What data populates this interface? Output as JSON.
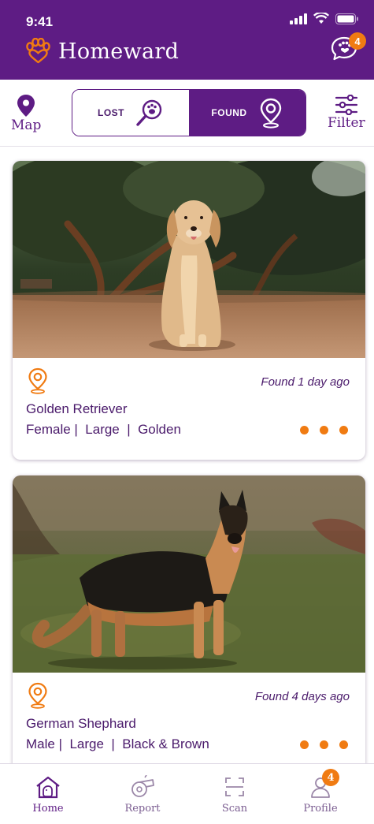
{
  "status_bar": {
    "time": "9:41"
  },
  "header": {
    "app_name": "Homeward",
    "chat_badge": "4"
  },
  "toolbar": {
    "map_label": "Map",
    "filter_label": "Filter",
    "lost_label": "LOST",
    "found_label": "FOUND",
    "selected": "FOUND"
  },
  "listings": [
    {
      "found_time": "Found 1 day ago",
      "breed": "Golden Retriever",
      "sex": "Female",
      "size": "Large",
      "color": "Golden"
    },
    {
      "found_time": "Found 4 days ago",
      "breed": "German Shephard",
      "sex": "Male",
      "size": "Large",
      "color": "Black & Brown"
    }
  ],
  "bottom_nav": {
    "items": [
      {
        "label": "Home",
        "icon": "home-icon"
      },
      {
        "label": "Report",
        "icon": "whistle-icon"
      },
      {
        "label": "Scan",
        "icon": "scan-icon"
      },
      {
        "label": "Profile",
        "icon": "profile-icon"
      }
    ],
    "profile_badge": "4"
  },
  "colors": {
    "brand_purple": "#5e1c84",
    "accent_orange": "#f07b12"
  }
}
